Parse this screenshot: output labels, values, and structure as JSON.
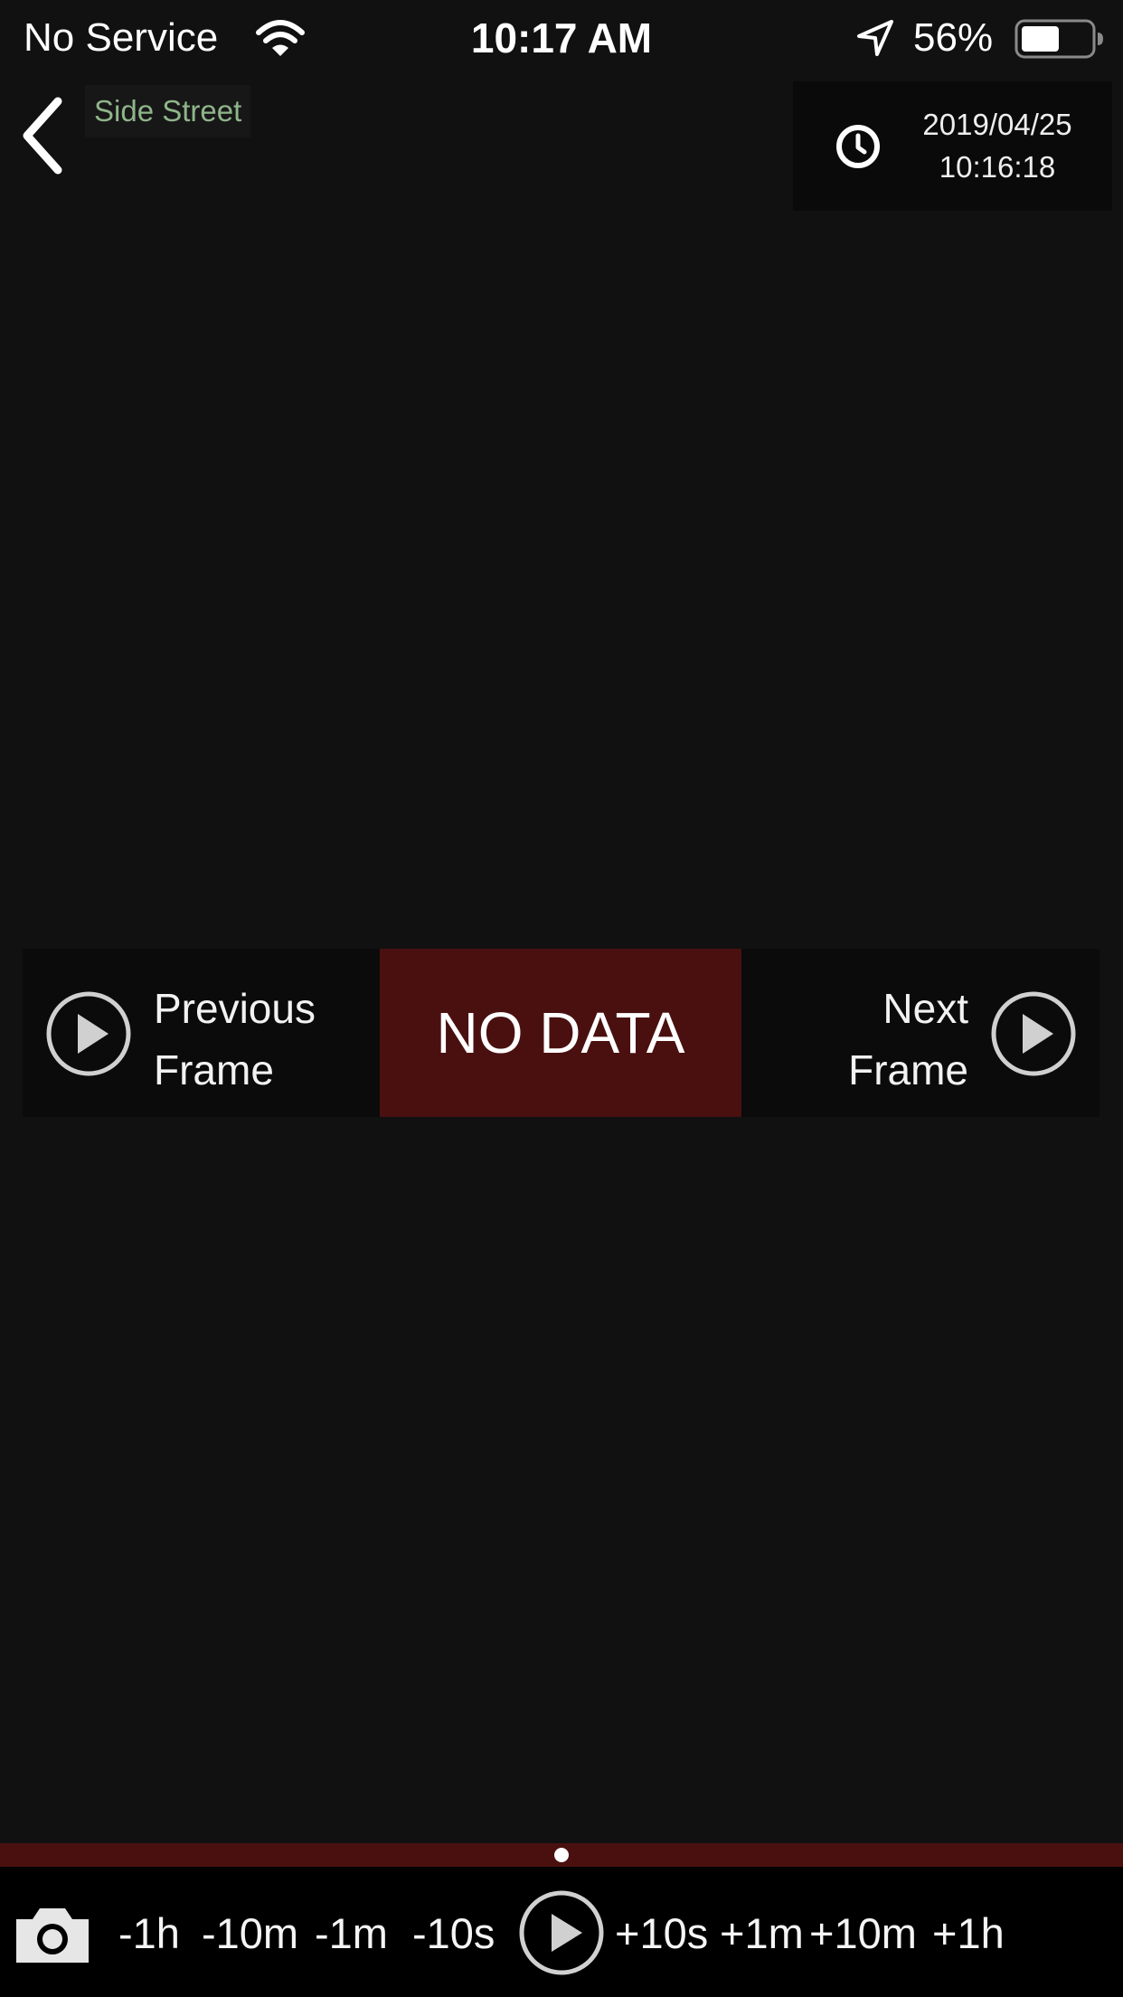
{
  "status_bar": {
    "carrier": "No Service",
    "time": "10:17 AM",
    "battery_percent": "56%",
    "battery_level": 0.56
  },
  "header": {
    "camera_name": "Side Street",
    "timestamp_date": "2019/04/25",
    "timestamp_time": "10:16:18"
  },
  "frame_nav": {
    "previous_label": "Previous Frame",
    "no_data_label": "NO DATA",
    "next_label": "Next Frame"
  },
  "timeline": {
    "position": 0.5
  },
  "controls": {
    "seek_back_1h": "-1h",
    "seek_back_10m": "-10m",
    "seek_back_1m": "-1m",
    "seek_back_10s": "-10s",
    "seek_fwd_10s": "+10s",
    "seek_fwd_1m": "+1m",
    "seek_fwd_10m": "+10m",
    "seek_fwd_1h": "+1h"
  },
  "icons": {
    "back": "chevron-left-icon",
    "clock": "clock-icon",
    "previous": "play-circle-icon",
    "next": "play-circle-icon",
    "snapshot": "camera-icon",
    "play": "play-circle-icon",
    "wifi": "wifi-icon",
    "location": "location-arrow-icon",
    "battery": "battery-icon"
  },
  "colors": {
    "background": "#111111",
    "camera_name_text": "#8fb58a",
    "no_data_background": "#4a1010",
    "timeline": "#4a1010",
    "controls_background": "#000000"
  }
}
